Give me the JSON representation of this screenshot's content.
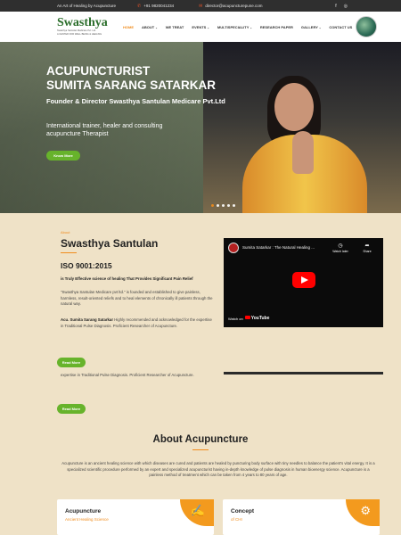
{
  "topbar": {
    "tagline": "An Art of Healing by Acupuncture",
    "phone": "+91 9820041234",
    "email": "director@acupuncturepune.com",
    "phone_icon": "phone-icon",
    "email_icon": "mail-icon",
    "social": [
      "facebook-icon",
      "instagram-icon"
    ]
  },
  "header": {
    "logo_text": "Swasthya",
    "logo_tagline_1": "Swasthya Santulan Medicare Pvt. Ltd.",
    "logo_tagline_2": "A CENTER FOR WELL BEING & HEALING",
    "nav": [
      "HOME",
      "ABOUT",
      "WE TREAT",
      "EVENTS",
      "MULTISPECIALITY",
      "RESEARCH PAPER",
      "GALLERY",
      "CONTACT US"
    ],
    "nav_dropdowns": [
      false,
      true,
      false,
      true,
      true,
      false,
      true,
      false
    ],
    "active_nav": "HOME"
  },
  "hero": {
    "title_line_1": "ACUPUNCTURIST",
    "title_line_2": "SUMITA SARANG SATARKAR",
    "subtitle": "Founder & Director Swasthya Santulan Medicare Pvt.Ltd",
    "description": "International trainer, healer and consulting acupuncture Therapist",
    "button": "Know More",
    "slide_count": 5,
    "active_slide": 0
  },
  "about": {
    "label": "About",
    "title": "Swasthya Santulan",
    "iso": "ISO 9001:2015",
    "science_line": "is Truly Effective science of healing That Provides Significant Pain Relief",
    "para_1": "\"Swasthya Santulan Medicare pvt ltd.\" is founded and established to give painless, harmless, result-oriented reliefs and to heal elements of chronically ill patients through the natural way.",
    "para_2_bold": "Acu. Sumita Sarang Satarkar",
    "para_2": " Highly recommended and acknowledged for the expertise in Traditional Pulse Diagnosis. Proficient Researcher of Acupuncture.",
    "button_1": "Read More",
    "para_3": "expertise in Traditional Pulse Diagnosis. Proficient Researcher of Acupuncture.",
    "button_2": "Read More"
  },
  "video": {
    "title": "Sumita Satarkar : The Natural Healing ...",
    "watch_later": "Watch later",
    "share": "Share",
    "watch_on": "Watch on",
    "youtube": "YouTube"
  },
  "acupuncture": {
    "title": "About Acupuncture",
    "paragraph": "Acupuncture is an ancient healing science with which diseases are cured and patients are healed by puncturing body surface with tiny needles to balance the patient's vital energy. It is a specialized scientific procedure performed by an expert and specialized acupuncturist having in-depth knowledge of pulse diagnosis in human bioenergy science. Acupuncture is a painless method of treatment which can be taken from 4 years to 80 years of age."
  },
  "cards": [
    {
      "title": "Acupuncture",
      "subtitle": "Ancient Healing Science",
      "icon": "needle-icon"
    },
    {
      "title": "Concept",
      "subtitle": "of CHI",
      "icon": "gear-icon"
    }
  ],
  "colors": {
    "accent": "#f08c1d",
    "button_green": "#67b32b",
    "topbar": "#2f2f2f",
    "page_bg": "#efe2c7"
  }
}
